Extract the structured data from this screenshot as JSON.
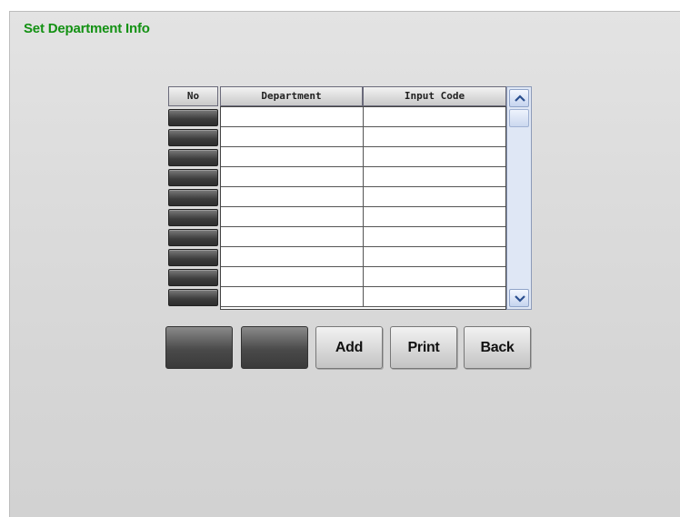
{
  "page": {
    "title": "Set Department Info"
  },
  "table": {
    "columns": [
      "No",
      "Department",
      "Input Code"
    ],
    "rows": [
      {
        "no": "",
        "department": "",
        "input_code": ""
      },
      {
        "no": "",
        "department": "",
        "input_code": ""
      },
      {
        "no": "",
        "department": "",
        "input_code": ""
      },
      {
        "no": "",
        "department": "",
        "input_code": ""
      },
      {
        "no": "",
        "department": "",
        "input_code": ""
      },
      {
        "no": "",
        "department": "",
        "input_code": ""
      },
      {
        "no": "",
        "department": "",
        "input_code": ""
      },
      {
        "no": "",
        "department": "",
        "input_code": ""
      },
      {
        "no": "",
        "department": "",
        "input_code": ""
      },
      {
        "no": "",
        "department": "",
        "input_code": ""
      }
    ]
  },
  "buttons": {
    "blank1": "",
    "blank2": "",
    "add": "Add",
    "print": "Print",
    "back": "Back"
  },
  "icons": {
    "scroll_up": "chevron-up-icon",
    "scroll_down": "chevron-down-icon"
  },
  "colors": {
    "title": "#139113",
    "scrollbar": "#dfe7f5"
  }
}
